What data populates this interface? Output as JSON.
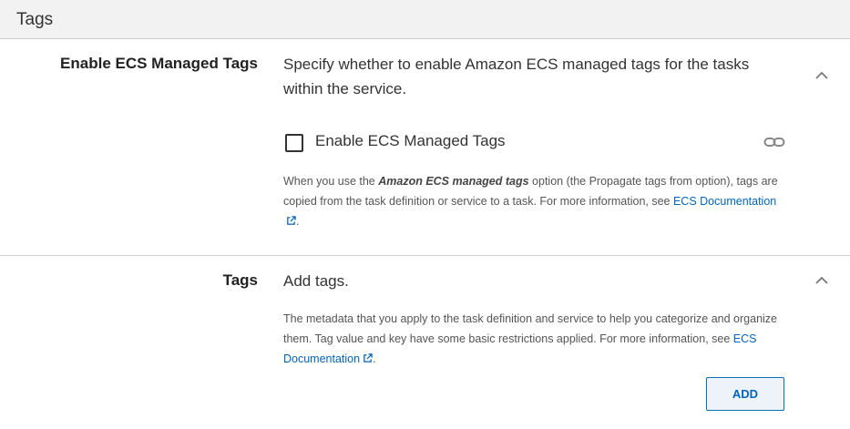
{
  "header": {
    "title": "Tags"
  },
  "managed_tags": {
    "label": "Enable ECS Managed Tags",
    "description": "Specify whether to enable Amazon ECS managed tags for the tasks within the service.",
    "checkbox_label": "Enable ECS Managed Tags",
    "checkbox_checked": false,
    "help_prefix": "When you use the ",
    "help_emphasis": "Amazon ECS managed tags",
    "help_middle": " option (the Propagate tags from option), tags are copied from the task definition or service to a task. For more information, see ",
    "help_link": "ECS Documentation",
    "help_suffix": "."
  },
  "tags": {
    "label": "Tags",
    "description": "Add tags.",
    "help_prefix": "The metadata that you apply to the task definition and service to help you categorize and organize them. Tag value and key have some basic restrictions applied. For more information, see ",
    "help_link": "ECS Documentation",
    "help_suffix": ".",
    "add_button_label": "ADD"
  },
  "colors": {
    "link": "#0066c0",
    "header_bg": "#f2f2f2",
    "divider": "#cfcfcf",
    "button_border": "#0073bb"
  },
  "icons": {
    "collapse": "chevron-up-icon",
    "link": "link-icon",
    "external": "external-link-icon",
    "checkbox": "checkbox-unchecked-icon"
  }
}
